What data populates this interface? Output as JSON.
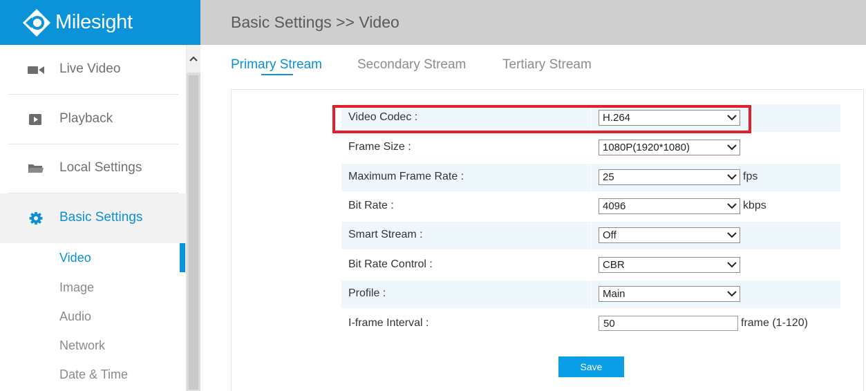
{
  "header": {
    "brand": "Milesight",
    "breadcrumb": "Basic Settings >> Video"
  },
  "sidebar": {
    "items": [
      {
        "label": "Live Video",
        "icon": "video-camera-icon"
      },
      {
        "label": "Playback",
        "icon": "play-icon"
      },
      {
        "label": "Local Settings",
        "icon": "folder-icon"
      },
      {
        "label": "Basic Settings",
        "icon": "gear-icon",
        "active": true
      }
    ],
    "subitems": [
      {
        "label": "Video",
        "active": true
      },
      {
        "label": "Image"
      },
      {
        "label": "Audio"
      },
      {
        "label": "Network"
      },
      {
        "label": "Date & Time"
      }
    ]
  },
  "tabs": [
    {
      "label": "Primary Stream",
      "active": true
    },
    {
      "label": "Secondary Stream"
    },
    {
      "label": "Tertiary Stream"
    }
  ],
  "form": {
    "video_codec": {
      "label": "Video Codec :",
      "value": "H.264"
    },
    "frame_size": {
      "label": "Frame Size :",
      "value": "1080P(1920*1080)"
    },
    "max_frame_rate": {
      "label": "Maximum Frame Rate :",
      "value": "25",
      "unit": "fps"
    },
    "bit_rate": {
      "label": "Bit Rate :",
      "value": "4096",
      "unit": "kbps"
    },
    "smart_stream": {
      "label": "Smart Stream :",
      "value": "Off"
    },
    "bit_rate_control": {
      "label": "Bit Rate Control :",
      "value": "CBR"
    },
    "profile": {
      "label": "Profile :",
      "value": "Main"
    },
    "iframe_interval": {
      "label": "I-frame Interval :",
      "value": "50",
      "unit": "frame (1-120)"
    }
  },
  "save_label": "Save",
  "colors": {
    "brand_blue": "#0a93d8",
    "accent_text": "#0a8fd4",
    "highlight_red": "#e0202a",
    "row_alt": "#eef8fc"
  }
}
